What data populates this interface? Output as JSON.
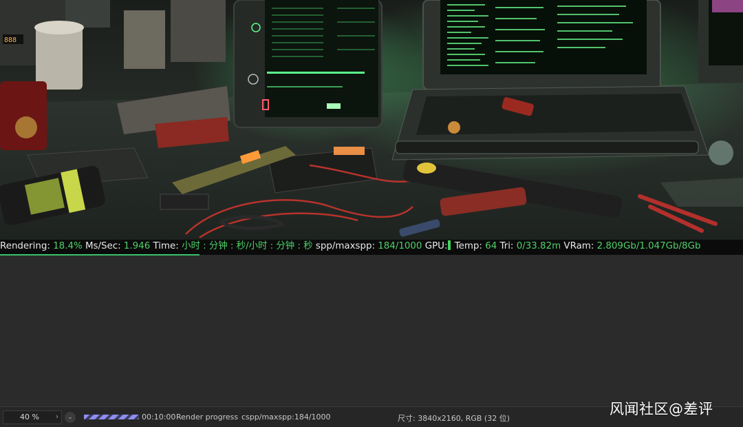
{
  "status": {
    "rendering_label": "Rendering:",
    "rendering_value": "18.4%",
    "mssec_label": "Ms/Sec:",
    "mssec_value": "1.946",
    "time_label": "Time:",
    "time_value": "小时 : 分钟 : 秒/小时 : 分钟 : 秒",
    "spp_label": "spp/maxspp:",
    "spp_value": "184/1000",
    "gpu_label": "GPU:",
    "temp_label": "Temp:",
    "temp_value": "64",
    "tri_label": "Tri:",
    "tri_value": "0/33.82m",
    "vram_label": "VRam:",
    "vram_value": "2.809Gb/1.047Gb/8Gb",
    "render_fraction": 0.184
  },
  "bottom": {
    "zoom_value": "40 %",
    "zoom_arrow": "›",
    "dropdown_glyph": "⌄",
    "render_time": "00:10:00",
    "render_progress_label": "Render progress",
    "cspp_label": "cspp/maxspp:184/1000",
    "size_label": "尺寸: 3840x2160, RGB (32 位)"
  },
  "watermark": "风闻社区@差评",
  "icons": {
    "zoom_arrow": "chevron-right-icon",
    "dropdown": "chevron-down-icon"
  },
  "colors": {
    "accent_green": "#4fd16a",
    "status_bg": "#0b0b0b",
    "panel_bg": "#2b2b2b",
    "progress_stripe": "#8e8ef0"
  }
}
